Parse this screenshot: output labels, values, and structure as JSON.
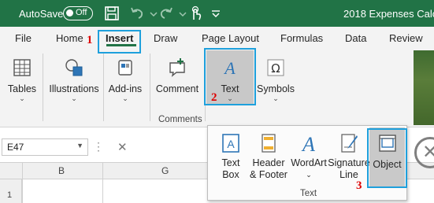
{
  "titlebar": {
    "autosave_label": "AutoSave",
    "toggle_state": "Off",
    "document_title": "2018 Expenses Calcula",
    "quick_access_icons": [
      "save-icon",
      "undo-icon",
      "redo-icon",
      "touch-mode-icon",
      "customize-icon"
    ],
    "accent_color": "#217346"
  },
  "tabs": [
    "File",
    "Home",
    "Insert",
    "Draw",
    "Page Layout",
    "Formulas",
    "Data",
    "Review"
  ],
  "active_tab": "Insert",
  "steps": [
    "1",
    "2",
    "3"
  ],
  "ribbon": {
    "tables": "Tables",
    "illustrations": "Illustrations",
    "addins": "Add-ins",
    "comment": "Comment",
    "text": "Text",
    "symbols": "Symbols",
    "comments_group": "Comments"
  },
  "formula_bar": {
    "name_box": "E47",
    "columns": [
      "B",
      "G"
    ],
    "row": "1"
  },
  "text_panel": {
    "text_box": [
      "Text",
      "Box"
    ],
    "header_footer": [
      "Header",
      "& Footer"
    ],
    "wordart": "WordArt",
    "signature_line": [
      "Signature",
      "Line"
    ],
    "object": "Object",
    "group_label": "Text"
  },
  "highlight_color": "#1ea0dc",
  "step_color": "#dd0000"
}
